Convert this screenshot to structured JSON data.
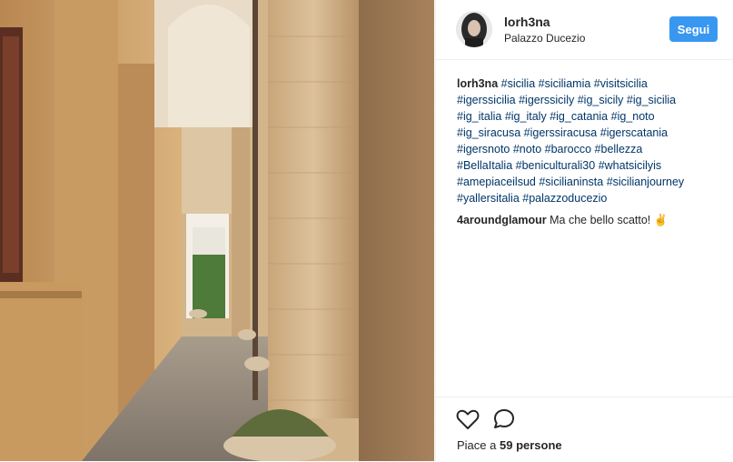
{
  "post": {
    "username": "lorh3na",
    "location": "Palazzo Ducezio",
    "follow_label": "Segui",
    "caption": {
      "user": "lorh3na",
      "lines": [
        [
          "#sicilia",
          "#siciliamia",
          "#visitsicilia"
        ],
        [
          "#igerssicilia",
          "#igerssicily",
          "#ig_sicily",
          "#ig_sicilia"
        ],
        [
          "#ig_italia",
          "#ig_italy",
          "#ig_catania",
          "#ig_noto"
        ],
        [
          "#ig_siracusa",
          "#igerssiracusa",
          "#igerscatania"
        ],
        [
          "#igersnoto",
          "#noto",
          "#barocco",
          "#bellezza"
        ],
        [
          "#BellaItalia",
          "#beniculturali30",
          "#whatsicilyis"
        ],
        [
          "#amepiaceilsud",
          "#sicilianinsta",
          "#sicilianjourney"
        ],
        [
          "#yallersitalia",
          "#palazzoducezio"
        ]
      ]
    },
    "comment": {
      "user": "4aroundglamour",
      "text": "Ma che bello scatto! ✌"
    },
    "likes_prefix": "Piace a",
    "likes_count": "59 persone"
  },
  "icons": {
    "like": "heart-icon",
    "comment": "comment-bubble-icon"
  }
}
